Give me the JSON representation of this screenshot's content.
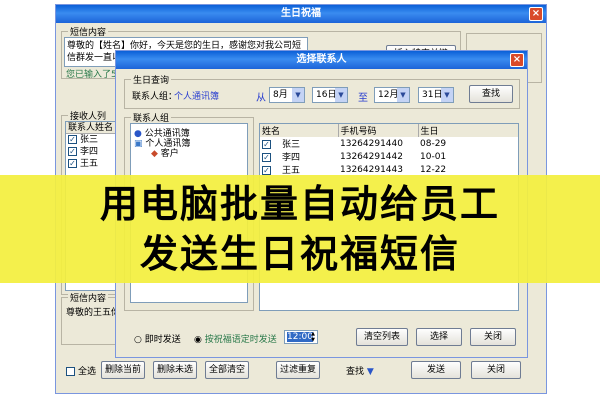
{
  "main": {
    "title": "生日祝福",
    "sms_group": "短信内容",
    "sms_text": "尊敬的【姓名】你好，今天是您的生日，感谢您对我公司短信群发一直以来的支",
    "sms_hint": "您已输入了5",
    "sms_right_btn": "插入特定关键",
    "recv_group": "接收人列表",
    "recv_header": "联系人姓名",
    "receivers": [
      "张三",
      "李四",
      "王五"
    ],
    "sms_group2": "短信内容",
    "sms_text2": "尊敬的王五你",
    "select_all": "全选",
    "buttons": [
      "删除当前",
      "删除未选",
      "全部清空",
      "过滤重复",
      "查找",
      "发送",
      "关闭"
    ]
  },
  "dialog": {
    "title": "选择联系人",
    "query_group": "生日查询",
    "group_label": "联系人组：",
    "group_value": "个人通讯簿",
    "from_label": "从",
    "to_label": "至",
    "month1": "8月",
    "day1": "16日",
    "month2": "12月",
    "day2": "31日",
    "search_btn": "查找",
    "contact_group": "联系人组",
    "tree": [
      "公共通讯簿",
      "个人通讯簿",
      "客户"
    ],
    "columns": [
      "姓名",
      "手机号码",
      "生日"
    ],
    "rows": [
      {
        "name": "张三",
        "phone": "13264291440",
        "birthday": "08-29"
      },
      {
        "name": "李四",
        "phone": "13264291442",
        "birthday": "10-01"
      },
      {
        "name": "王五",
        "phone": "13264291443",
        "birthday": "12-22"
      }
    ],
    "radio1": "即时发送",
    "radio2": "按祝福语定时发送",
    "time": "12:00",
    "clear_btn": "清空列表",
    "select_btn": "选择",
    "close_btn": "关闭"
  },
  "banner": {
    "line1": "用电脑批量自动给员工",
    "line2": "发送生日祝福短信"
  }
}
